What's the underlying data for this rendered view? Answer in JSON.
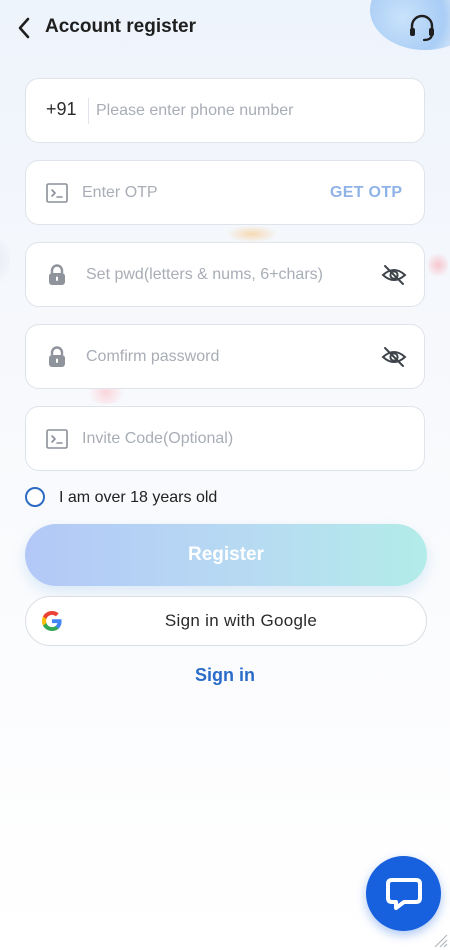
{
  "header": {
    "title": "Account register",
    "back_icon": "chevron-left-icon",
    "support_icon": "headset-icon"
  },
  "form": {
    "phone": {
      "prefix": "+91",
      "placeholder": "Please enter phone number",
      "value": ""
    },
    "otp": {
      "placeholder": "Enter OTP",
      "value": "",
      "action_label": "GET OTP",
      "icon": "terminal-icon"
    },
    "password": {
      "placeholder": "Set pwd(letters & nums, 6+chars)",
      "value": "",
      "icon": "lock-icon",
      "toggle_icon": "eye-off-icon"
    },
    "confirm_password": {
      "placeholder": "Comfirm password",
      "value": "",
      "icon": "lock-icon",
      "toggle_icon": "eye-off-icon"
    },
    "invite": {
      "placeholder": "Invite Code(Optional)",
      "value": "",
      "icon": "terminal-icon"
    },
    "age_check": {
      "label": "I am over 18 years old",
      "checked": false
    }
  },
  "buttons": {
    "register": "Register",
    "google": "Sign in with Google",
    "signin": "Sign in"
  },
  "colors": {
    "accent": "#2a6cc8",
    "get_otp": "#8fb3e6",
    "chat_fab": "#1760de",
    "register_start": "#b3c8f7",
    "register_end": "#b2ece9"
  }
}
